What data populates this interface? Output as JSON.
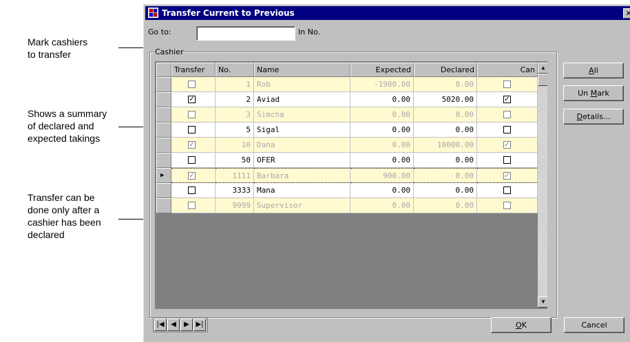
{
  "annotations": {
    "mark": "Mark cashiers\nto transfer",
    "summary": "Shows a summary\nof declared and\nexpected takings",
    "transfer": "Transfer can be\ndone only after a\ncashier has been\ndeclared"
  },
  "window": {
    "title": "Transfer Current to Previous",
    "close_icon": "close-icon",
    "goto_label": "Go to:",
    "goto_value": "",
    "in_no_label": "In No.",
    "group_title": "Cashier"
  },
  "table": {
    "columns": [
      "Transfer",
      "No.",
      "Name",
      "Expected",
      "Declared",
      "Can"
    ],
    "rows": [
      {
        "transfer": false,
        "no": "1",
        "name": "Rob",
        "expected": "-1900.00",
        "declared": "0.00",
        "can": false,
        "dim": true
      },
      {
        "transfer": true,
        "no": "2",
        "name": "Aviad",
        "expected": "0.00",
        "declared": "5020.00",
        "can": true,
        "dim": false
      },
      {
        "transfer": false,
        "no": "3",
        "name": "Simcha",
        "expected": "0.00",
        "declared": "0.00",
        "can": false,
        "dim": true
      },
      {
        "transfer": false,
        "no": "5",
        "name": "Sigal",
        "expected": "0.00",
        "declared": "0.00",
        "can": false,
        "dim": false
      },
      {
        "transfer": true,
        "no": "10",
        "name": "Dana",
        "expected": "0.00",
        "declared": "10000.00",
        "can": true,
        "dim": true
      },
      {
        "transfer": false,
        "no": "50",
        "name": "OFER",
        "expected": "0.00",
        "declared": "0.00",
        "can": false,
        "dim": false
      },
      {
        "transfer": true,
        "no": "1111",
        "name": "Barbara",
        "expected": "900.00",
        "declared": "0.00",
        "can": true,
        "dim": true,
        "current": true
      },
      {
        "transfer": false,
        "no": "3333",
        "name": "Mana",
        "expected": "0.00",
        "declared": "0.00",
        "can": false,
        "dim": false
      },
      {
        "transfer": false,
        "no": "9999",
        "name": "Supervisor",
        "expected": "0.00",
        "declared": "0.00",
        "can": false,
        "dim": true
      }
    ]
  },
  "buttons": {
    "all": {
      "mnemonic": "A",
      "rest": "ll"
    },
    "unmark": {
      "pre": "Un ",
      "mnemonic": "M",
      "rest": "ark"
    },
    "details": {
      "mnemonic": "D",
      "rest": "etails..."
    },
    "ok": {
      "mnemonic": "O",
      "rest": "K"
    },
    "cancel": "Cancel"
  },
  "nav": [
    "|◀",
    "◀",
    "▶",
    "▶|"
  ],
  "colors": {
    "title_bar": "#000080",
    "dim_row_bg": "#fff8c0",
    "dim_text": "#a8a8a8"
  }
}
